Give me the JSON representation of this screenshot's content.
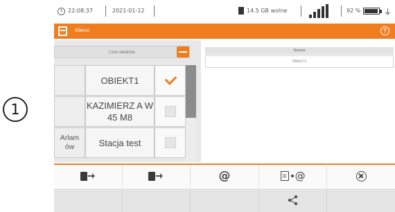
{
  "callout": {
    "number": "1"
  },
  "status_bar": {
    "time": "22:08:37",
    "date": "2021-01-12",
    "storage": "14.5 GB wolne",
    "battery_percent": "92 %"
  },
  "title_bar": {
    "title": "Klienci",
    "help_icon": "help-icon"
  },
  "list": {
    "header": "Lista obiektów",
    "rows": [
      {
        "left": "",
        "name": "OBIEKT1",
        "checked": true
      },
      {
        "left": "",
        "name": "KAZIMIERZ A W 45 M8",
        "checked": false
      },
      {
        "left": "Arlam ów",
        "name": "Stacja test",
        "checked": false
      }
    ]
  },
  "details": {
    "header": "Nazwa",
    "value": "OBIEKT1"
  },
  "toolbar": {
    "icons": [
      "file-export-icon",
      "file-export-icon",
      "email-icon",
      "document-email-icon",
      "close-circle-icon"
    ]
  },
  "bottom_bar": {
    "icons": [
      "share-icon"
    ]
  },
  "colors": {
    "accent": "#f07d1f",
    "scroll_thumb": "#8c8c8c"
  }
}
